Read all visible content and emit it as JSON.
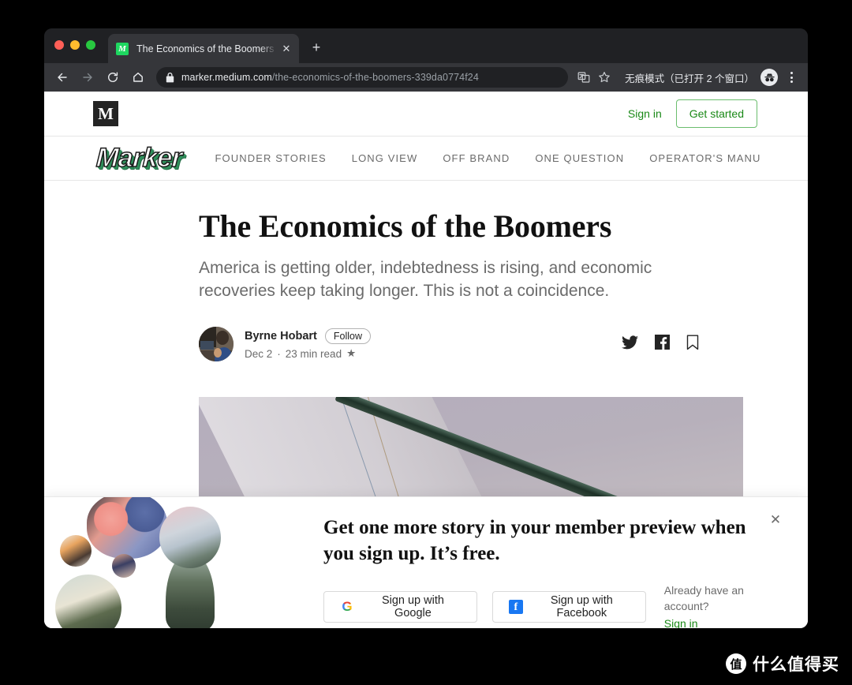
{
  "browser": {
    "tab": {
      "title": "The Economics of the Boomers -",
      "favicon_letter": "M",
      "close_label": "✕"
    },
    "new_tab_label": "+",
    "nav": {
      "back_label": "←",
      "forward_label": "→",
      "reload_label": "⟳",
      "home_label": "⌂"
    },
    "omnibox": {
      "host": "marker.medium.com",
      "path": "/the-economics-of-the-boomers-339da0774f24",
      "lock_icon": "lock-icon",
      "translate_icon": "translate-icon",
      "bookmark_icon": "star-icon"
    },
    "incognito_label": "无痕模式（已打开 2 个窗口）",
    "menu_icon": "kebab-menu-icon"
  },
  "medium_header": {
    "logo_letter": "M",
    "sign_in_label": "Sign in",
    "get_started_label": "Get started"
  },
  "marker_nav": {
    "logo": "Marker",
    "items": [
      {
        "label": "FOUNDER STORIES"
      },
      {
        "label": "LONG VIEW"
      },
      {
        "label": "OFF BRAND"
      },
      {
        "label": "ONE QUESTION"
      },
      {
        "label": "OPERATOR'S MANU"
      }
    ]
  },
  "article": {
    "title": "The Economics of the Boomers",
    "subtitle": "America is getting older, indebtedness is rising, and economic recoveries keep taking longer. This is not a coincidence.",
    "author": "Byrne Hobart",
    "follow_label": "Follow",
    "date": "Dec 2",
    "separator": "·",
    "read_time": "23 min read",
    "member_star": "★",
    "share": {
      "twitter_icon": "twitter-icon",
      "facebook_icon": "facebook-icon",
      "bookmark_icon": "bookmark-icon"
    }
  },
  "signup_banner": {
    "heading": "Get one more story in your member preview when you sign up. It’s free.",
    "google_label": "Sign up with Google",
    "google_icon_letter": "G",
    "facebook_label": "Sign up with Facebook",
    "facebook_icon_letter": "f",
    "already_account": "Already have an account?",
    "sign_in_label": "Sign in",
    "close_label": "✕"
  },
  "watermark": {
    "logo_char": "值",
    "text": "什么值得买"
  },
  "colors": {
    "medium_green": "#1a8917",
    "chrome_dark": "#202124",
    "chrome_toolbar": "#35363a",
    "facebook_blue": "#1877f2"
  }
}
